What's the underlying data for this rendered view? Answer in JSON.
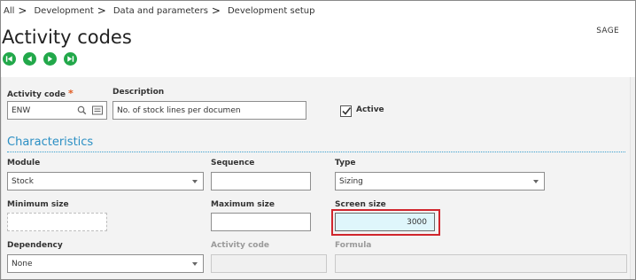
{
  "breadcrumb": {
    "items": [
      "All",
      "Development",
      "Data and parameters",
      "Development setup"
    ],
    "separator": ">"
  },
  "page": {
    "title": "Activity codes",
    "folder": "SAGE"
  },
  "nav_buttons": [
    "first-record-icon",
    "previous-record-icon",
    "next-record-icon",
    "last-record-icon"
  ],
  "form": {
    "activity_code": {
      "label": "Activity code",
      "required_mark": "*",
      "value": "ENW"
    },
    "description": {
      "label": "Description",
      "value": "No. of stock lines per documen"
    },
    "active": {
      "label": "Active",
      "checked": true
    }
  },
  "characteristics": {
    "title": "Characteristics",
    "module": {
      "label": "Module",
      "value": "Stock"
    },
    "sequence": {
      "label": "Sequence",
      "value": ""
    },
    "type": {
      "label": "Type",
      "value": "Sizing"
    },
    "minimum_size": {
      "label": "Minimum size",
      "value": ""
    },
    "maximum_size": {
      "label": "Maximum size",
      "value": ""
    },
    "screen_size": {
      "label": "Screen size",
      "value": "3000"
    },
    "dependency": {
      "label": "Dependency",
      "value": "None"
    },
    "dep_activity_code": {
      "label": "Activity code",
      "value": ""
    },
    "formula": {
      "label": "Formula",
      "value": ""
    }
  },
  "colors": {
    "accent": "#2b8fc4",
    "nav_green": "#22a84a",
    "highlight_border": "#d0262d",
    "required": "#e05a1f"
  }
}
